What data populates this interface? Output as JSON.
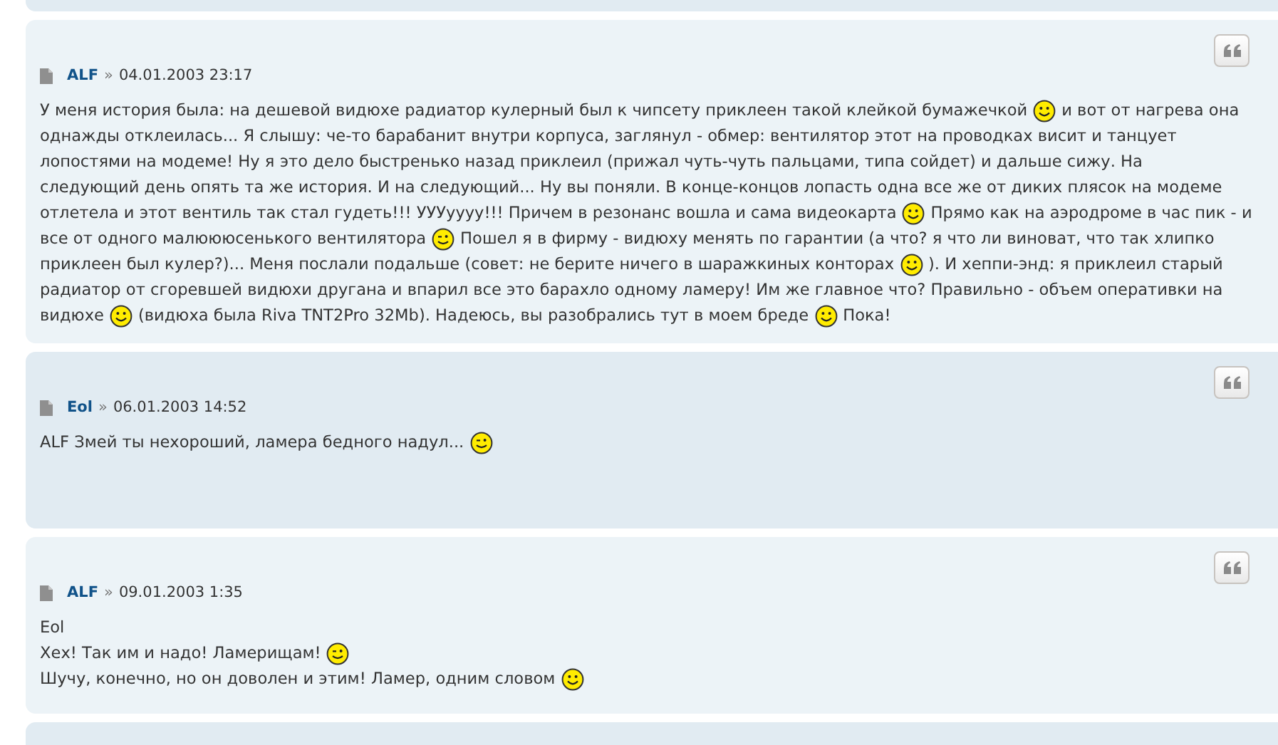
{
  "posts": [
    {
      "author": "ALF",
      "separator": "»",
      "date": "04.01.2003 23:17",
      "lines": [
        [
          {
            "kind": "text",
            "text": "У меня история была: на дешевой видюхе радиатор кулерный был к чипсету приклеен такой клейкой бумажечкой"
          },
          {
            "kind": "smile"
          },
          {
            "kind": "text",
            "text": "и вот от нагрева она"
          }
        ],
        [
          {
            "kind": "text",
            "text": "однажды отклеилась... Я слышу: че-то барабанит внутри корпуса, заглянул - обмер: вентилятор этот на проводках висит и танцует"
          }
        ],
        [
          {
            "kind": "text",
            "text": "лопостями на модеме! Ну я это дело быстренько назад приклеил (прижал чуть-чуть пальцами, типа сойдет) и дальше сижу. На"
          }
        ],
        [
          {
            "kind": "text",
            "text": "следующий день опять та же история. И на следующий... Ну вы поняли. В конце-концов лопасть одна все же от диких плясок на модеме"
          }
        ],
        [
          {
            "kind": "text",
            "text": "отлетела и этот вентиль так стал гудеть!!! УУУуууу!!! Причем в резонанс вошла и сама видеокарта"
          },
          {
            "kind": "smile"
          },
          {
            "kind": "text",
            "text": "Прямо как на аэродроме в час пик - и"
          }
        ],
        [
          {
            "kind": "text",
            "text": "все от одного малюююсенького вентилятора"
          },
          {
            "kind": "wink"
          },
          {
            "kind": "text",
            "text": "Пошел я в фирму - видюху менять по гарантии (а что? я что ли виноват, что так хлипко"
          }
        ],
        [
          {
            "kind": "text",
            "text": "приклеен был кулер?)... Меня послали подальше (совет: не берите ничего в шаражкиных конторах"
          },
          {
            "kind": "smile"
          },
          {
            "kind": "text",
            "text": "). И хеппи-энд: я приклеил старый"
          }
        ],
        [
          {
            "kind": "text",
            "text": "радиатор от сгоревшей видюхи другана и впарил все это барахло одному ламеру! Им же главное что? Правильно - объем оперативки на"
          }
        ],
        [
          {
            "kind": "text",
            "text": "видюхе"
          },
          {
            "kind": "smile"
          },
          {
            "kind": "text",
            "text": "(видюха была Riva TNT2Pro 32Mb). Надеюсь, вы разобрались тут в моем бреде"
          },
          {
            "kind": "smile"
          },
          {
            "kind": "text",
            "text": "Пока!"
          }
        ]
      ]
    },
    {
      "author": "Eol",
      "separator": "»",
      "date": "06.01.2003 14:52",
      "lines": [
        [
          {
            "kind": "text",
            "text": "ALF Змей ты нехороший, ламера бедного надул..."
          },
          {
            "kind": "wink"
          }
        ]
      ]
    },
    {
      "author": "ALF",
      "separator": "»",
      "date": "09.01.2003 1:35",
      "lines": [
        [
          {
            "kind": "text",
            "text": "Eol"
          }
        ],
        [
          {
            "kind": "text",
            "text": "Хех! Так им и надо! Ламерищам!"
          },
          {
            "kind": "wink"
          }
        ],
        [
          {
            "kind": "text",
            "text": "Шучу, конечно, но он доволен и этим! Ламер, одним словом"
          },
          {
            "kind": "smile"
          }
        ]
      ]
    }
  ]
}
